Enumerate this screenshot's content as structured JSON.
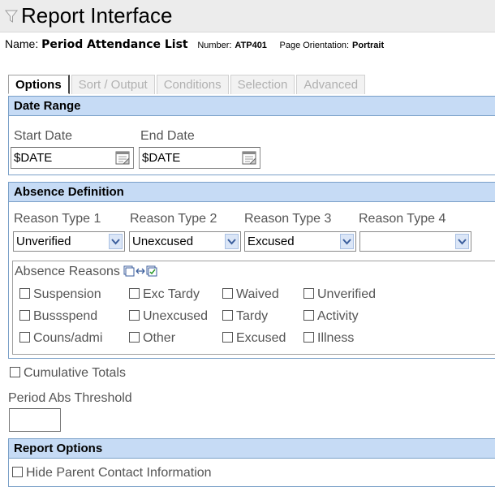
{
  "header": {
    "title": "Report Interface"
  },
  "report": {
    "name_label": "Name:",
    "name_value": "Period Attendance List",
    "number_label": "Number:",
    "number_value": "ATP401",
    "orientation_label": "Page Orientation:",
    "orientation_value": "Portrait"
  },
  "tabs": [
    {
      "label": "Options",
      "active": true
    },
    {
      "label": "Sort / Output",
      "active": false
    },
    {
      "label": "Conditions",
      "active": false
    },
    {
      "label": "Selection",
      "active": false
    },
    {
      "label": "Advanced",
      "active": false
    }
  ],
  "date_range": {
    "heading": "Date Range",
    "start_label": "Start Date",
    "end_label": "End Date",
    "start_value": "$DATE",
    "end_value": "$DATE"
  },
  "absence_definition": {
    "heading": "Absence Definition",
    "reason_types": [
      {
        "label": "Reason Type 1",
        "value": "Unverified"
      },
      {
        "label": "Reason Type 2",
        "value": "Unexcused"
      },
      {
        "label": "Reason Type 3",
        "value": "Excused"
      },
      {
        "label": "Reason Type 4",
        "value": ""
      }
    ],
    "reasons_label": "Absence Reasons",
    "reasons": [
      {
        "label": "Suspension",
        "checked": false
      },
      {
        "label": "Exc Tardy",
        "checked": false
      },
      {
        "label": "Waived",
        "checked": false
      },
      {
        "label": "Unverified",
        "checked": false
      },
      {
        "label": "Bussspend",
        "checked": false
      },
      {
        "label": "Unexcused",
        "checked": false
      },
      {
        "label": "Tardy",
        "checked": false
      },
      {
        "label": "Activity",
        "checked": false
      },
      {
        "label": "Couns/admi",
        "checked": false
      },
      {
        "label": "Other",
        "checked": false
      },
      {
        "label": "Excused",
        "checked": false
      },
      {
        "label": "Illness",
        "checked": false
      }
    ]
  },
  "cumulative": {
    "label": "Cumulative Totals",
    "checked": false
  },
  "threshold": {
    "label": "Period Abs Threshold",
    "value": ""
  },
  "report_options": {
    "heading": "Report Options",
    "hide_parent": {
      "label": "Hide Parent Contact Information",
      "checked": false
    }
  }
}
